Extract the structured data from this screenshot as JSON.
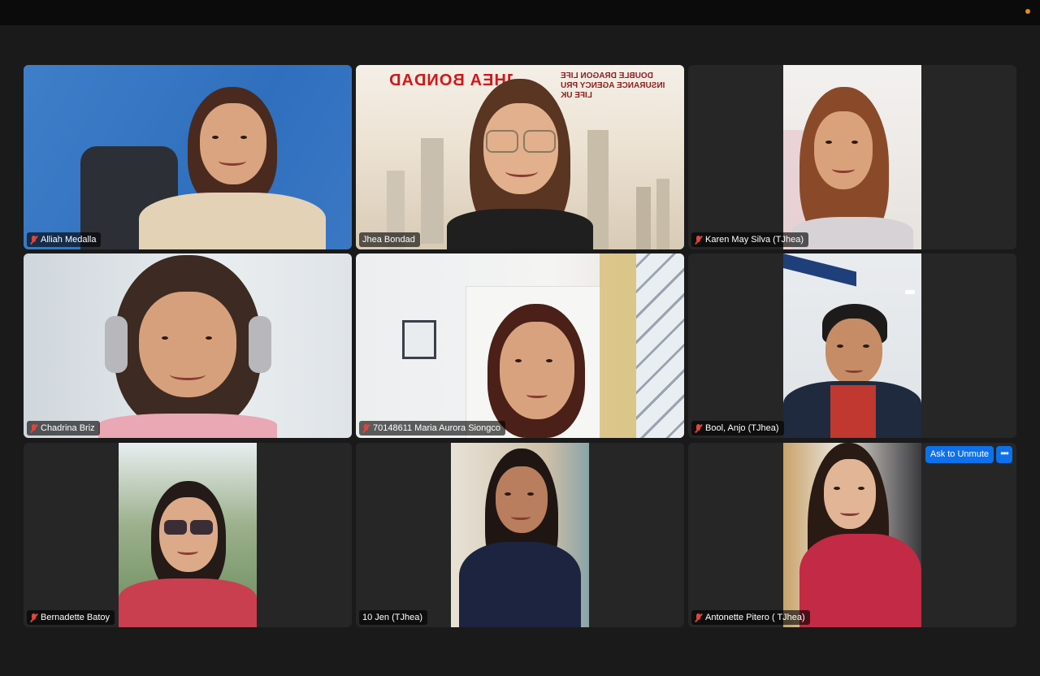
{
  "meeting": {
    "recording_indicator_color": "#e88a1a",
    "active_speaker_border_color": "#2fbd4a"
  },
  "tiles": [
    {
      "name": "Alliah Medalla",
      "muted": true
    },
    {
      "name": "Jhea Bondad",
      "muted": false,
      "active_speaker": true,
      "background_banner": "JHEA BONDAD",
      "background_logo": "DOUBLE DRAGON LIFE INSURANCE AGENCY PRU LIFE UK"
    },
    {
      "name": "Karen May Silva (TJhea)",
      "muted": true
    },
    {
      "name": "Chadrina Briz",
      "muted": true
    },
    {
      "name": "70148611 Maria Aurora Siongco",
      "muted": true
    },
    {
      "name": "Bool, Anjo (TJhea)",
      "muted": true
    },
    {
      "name": "Bernadette Batoy",
      "muted": true
    },
    {
      "name": "10 Jen (TJhea)",
      "muted": false
    },
    {
      "name": "Antonette Pitero ( TJhea)",
      "muted": true
    }
  ],
  "controls": {
    "ask_to_unmute_label": "Ask to Unmute",
    "more_label": "•••",
    "button_color": "#0e71eb"
  }
}
